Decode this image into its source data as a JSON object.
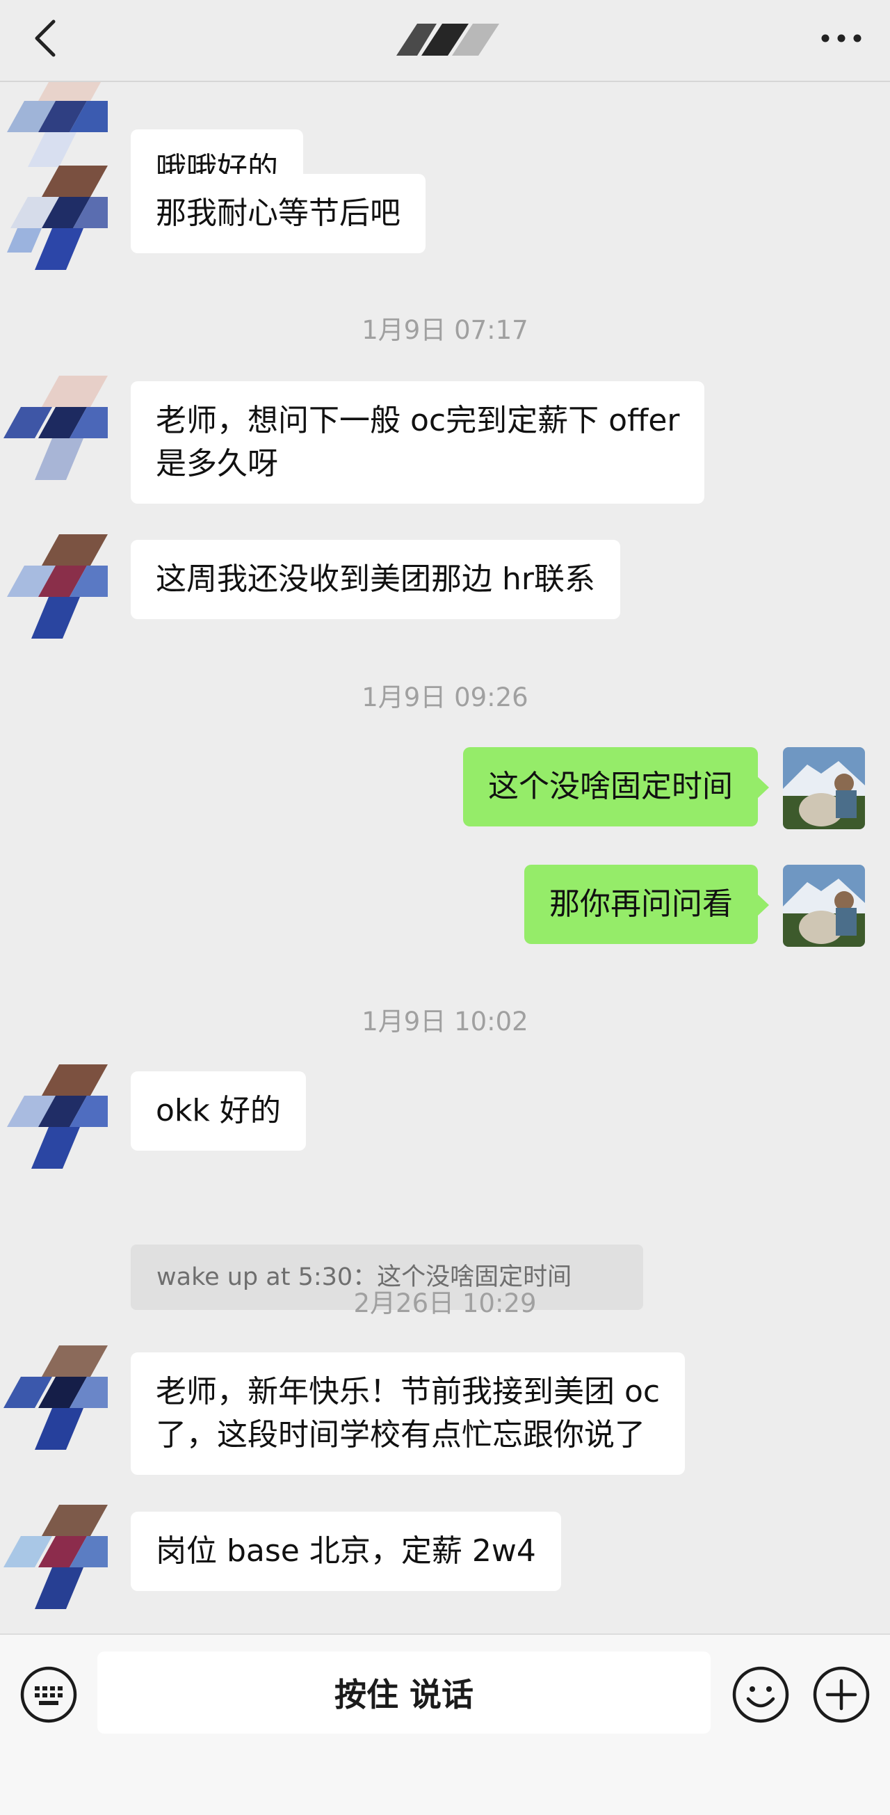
{
  "header": {
    "back_icon": "chevron-left-icon",
    "more_icon": "more-dots-icon"
  },
  "messages": [
    {
      "type": "incoming",
      "text": "哦哦好的"
    },
    {
      "type": "incoming",
      "text": "那我耐心等节后吧"
    },
    {
      "type": "timestamp",
      "text": "1月9日 07:17"
    },
    {
      "type": "incoming",
      "text": "老师，想问下一般 oc完到定薪下 offer\n是多久呀"
    },
    {
      "type": "incoming",
      "text": "这周我还没收到美团那边 hr联系"
    },
    {
      "type": "timestamp",
      "text": "1月9日 09:26"
    },
    {
      "type": "outgoing",
      "text": "这个没啥固定时间"
    },
    {
      "type": "outgoing",
      "text": "那你再问问看"
    },
    {
      "type": "timestamp",
      "text": "1月9日 10:02"
    },
    {
      "type": "incoming",
      "text": "okk 好的"
    },
    {
      "type": "quote",
      "text": "wake up at 5:30：这个没啥固定时间"
    },
    {
      "type": "timestamp",
      "text": "2月26日 10:29"
    },
    {
      "type": "incoming",
      "text": "老师，新年快乐！节前我接到美团 oc\n了，这段时间学校有点忙忘跟你说了"
    },
    {
      "type": "incoming",
      "text": "岗位 base 北京，定薪 2w4"
    }
  ],
  "input_bar": {
    "hold_to_talk_label": "按住 说话",
    "keyboard_icon": "keyboard-icon",
    "emoji_icon": "emoji-smile-icon",
    "plus_icon": "plus-circle-icon"
  },
  "colors": {
    "background": "#ededed",
    "incoming_bubble": "#ffffff",
    "outgoing_bubble": "#95ec69",
    "timestamp_text": "#a0a0a0"
  }
}
